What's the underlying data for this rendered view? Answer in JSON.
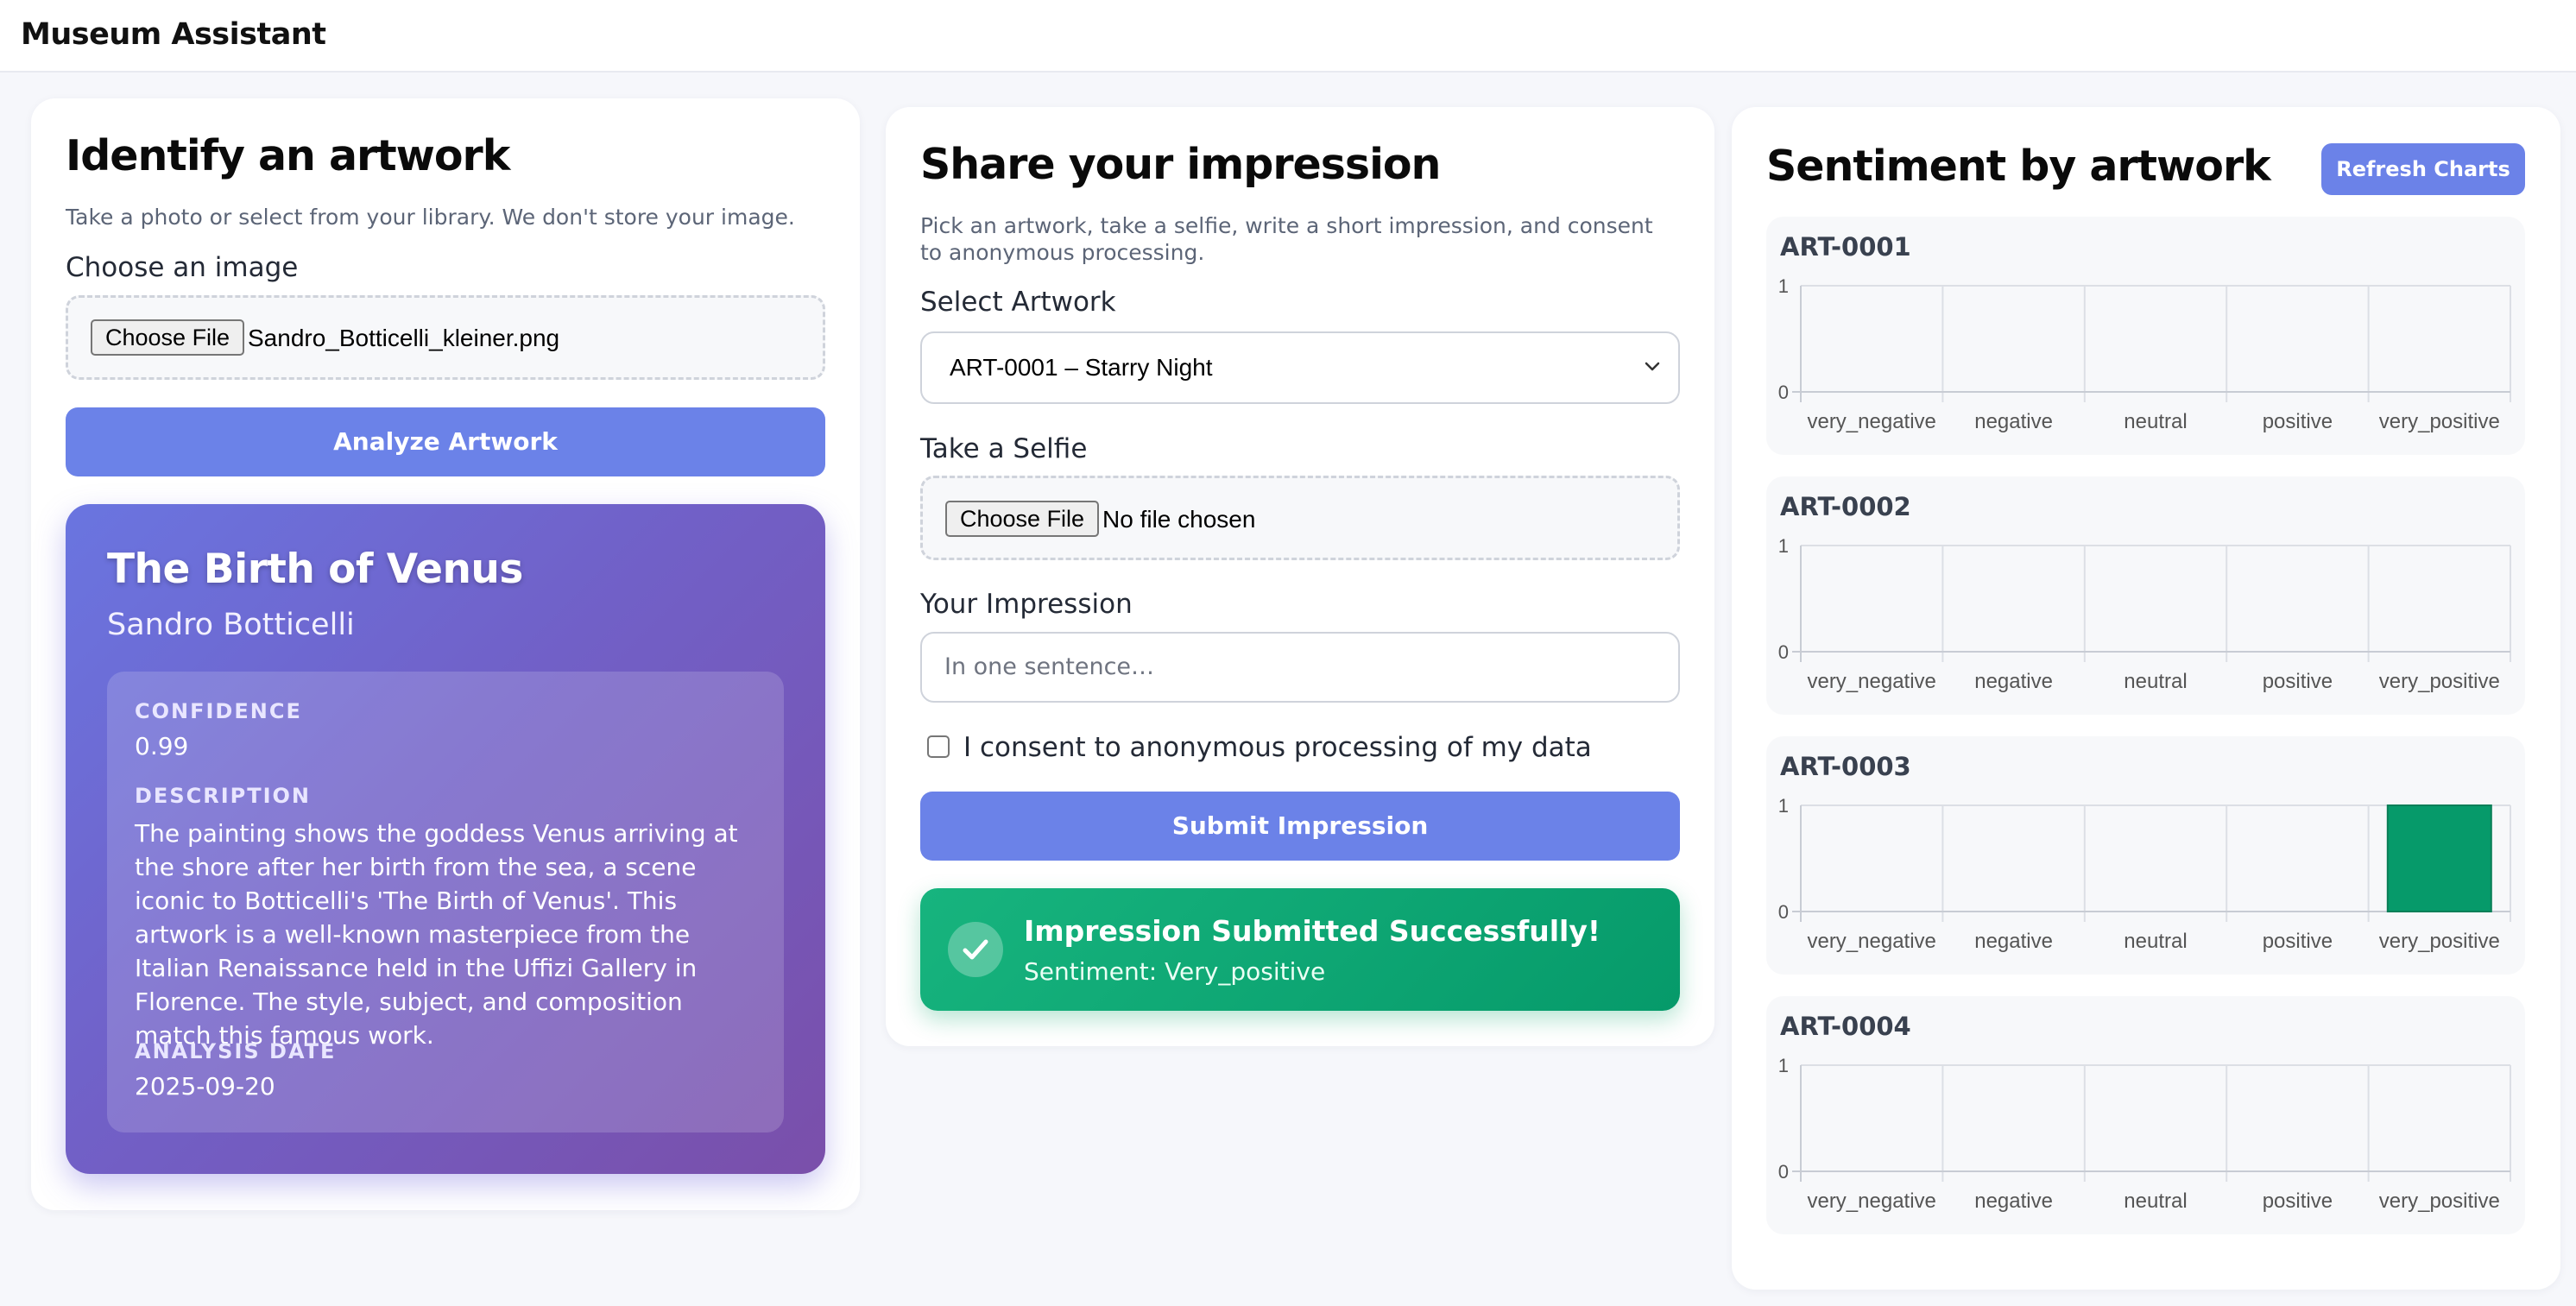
{
  "app": {
    "title": "Museum Assistant"
  },
  "identify": {
    "title": "Identify an artwork",
    "subtitle": "Take a photo or select from your library. We don't store your image.",
    "image_label": "Choose an image",
    "file_button": "Choose File",
    "file_name": "Sandro_Botticelli_kleiner.png",
    "analyze_button": "Analyze Artwork",
    "result": {
      "title": "The Birth of Venus",
      "artist": "Sandro Botticelli",
      "confidence_label": "CONFIDENCE",
      "confidence_value": "0.99",
      "description_label": "DESCRIPTION",
      "description_value": "The painting shows the goddess Venus arriving at the shore after her birth from the sea, a scene iconic to Botticelli's 'The Birth of Venus'. This artwork is a well-known masterpiece from the Italian Renaissance held in the Uffizi Gallery in Florence. The style, subject, and composition match this famous work.",
      "date_label": "ANALYSIS DATE",
      "date_value": "2025-09-20"
    }
  },
  "impression": {
    "title": "Share your impression",
    "subtitle": "Pick an artwork, take a selfie, write a short impression, and consent to anonymous processing.",
    "artwork_label": "Select Artwork",
    "artwork_selected": "ART-0001 – Starry Night",
    "selfie_label": "Take a Selfie",
    "selfie_button": "Choose File",
    "selfie_file": "No file chosen",
    "impression_label": "Your Impression",
    "impression_placeholder": "In one sentence…",
    "impression_value": "",
    "consent_label": "I consent to anonymous processing of my data",
    "consent_checked": false,
    "submit_button": "Submit Impression",
    "success_title": "Impression Submitted Successfully!",
    "success_sentiment": "Sentiment: Very_positive"
  },
  "sentiment": {
    "title": "Sentiment by artwork",
    "refresh_button": "Refresh Charts"
  },
  "colors": {
    "accent": "#6b82e8",
    "success": "#10a56f",
    "bar": "#069a6a"
  },
  "chart_data": [
    {
      "type": "bar",
      "title": "ART-0001",
      "categories": [
        "very_negative",
        "negative",
        "neutral",
        "positive",
        "very_positive"
      ],
      "values": [
        0,
        0,
        0,
        0,
        0
      ],
      "ylim": [
        0,
        1
      ],
      "yticks": [
        "0",
        "1"
      ],
      "grid": true
    },
    {
      "type": "bar",
      "title": "ART-0002",
      "categories": [
        "very_negative",
        "negative",
        "neutral",
        "positive",
        "very_positive"
      ],
      "values": [
        0,
        0,
        0,
        0,
        0
      ],
      "ylim": [
        0,
        1
      ],
      "yticks": [
        "0",
        "1"
      ],
      "grid": true
    },
    {
      "type": "bar",
      "title": "ART-0003",
      "categories": [
        "very_negative",
        "negative",
        "neutral",
        "positive",
        "very_positive"
      ],
      "values": [
        0,
        0,
        0,
        0,
        1
      ],
      "ylim": [
        0,
        1
      ],
      "yticks": [
        "0",
        "1"
      ],
      "grid": true
    },
    {
      "type": "bar",
      "title": "ART-0004",
      "categories": [
        "very_negative",
        "negative",
        "neutral",
        "positive",
        "very_positive"
      ],
      "values": [
        0,
        0,
        0,
        0,
        0
      ],
      "ylim": [
        0,
        1
      ],
      "yticks": [
        "0",
        "1"
      ],
      "grid": true
    }
  ]
}
